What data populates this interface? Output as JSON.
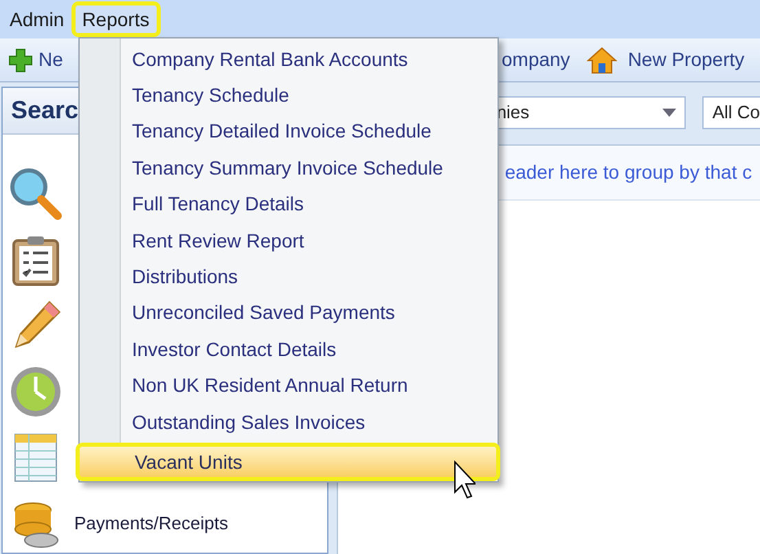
{
  "menubar": [
    {
      "label": "Admin",
      "selected": false
    },
    {
      "label": "Reports",
      "selected": true
    }
  ],
  "toolbar": [
    {
      "label": "Ne",
      "kind": "plus"
    },
    {
      "label": "ompany",
      "kind": "none"
    },
    {
      "label": "New Property",
      "kind": "house"
    }
  ],
  "sidebar": {
    "title": "Searc",
    "items": [
      {
        "kind": "magnifier"
      },
      {
        "kind": "clipboard"
      },
      {
        "kind": "pencil"
      },
      {
        "kind": "clock"
      },
      {
        "kind": "sheet"
      },
      {
        "kind": "coins",
        "label": "Payments/Receipts"
      }
    ]
  },
  "filters": {
    "dropdown": "nies",
    "second": "All Co"
  },
  "group_hint": "eader here to group by that c",
  "menu": {
    "items": [
      {
        "label": "Company Rental Bank Accounts",
        "selected": false
      },
      {
        "label": "Tenancy Schedule",
        "selected": false
      },
      {
        "label": "Tenancy Detailed Invoice Schedule",
        "selected": false
      },
      {
        "label": "Tenancy Summary Invoice Schedule",
        "selected": false
      },
      {
        "label": "Full Tenancy Details",
        "selected": false
      },
      {
        "label": "Rent Review Report",
        "selected": false
      },
      {
        "label": "Distributions",
        "selected": false
      },
      {
        "label": "Unreconciled Saved Payments",
        "selected": false
      },
      {
        "label": "Investor Contact Details",
        "selected": false
      },
      {
        "label": "Non UK Resident Annual Return",
        "selected": false
      },
      {
        "label": "Outstanding Sales Invoices",
        "selected": false
      },
      {
        "label": "Vacant Units",
        "selected": true
      }
    ]
  }
}
